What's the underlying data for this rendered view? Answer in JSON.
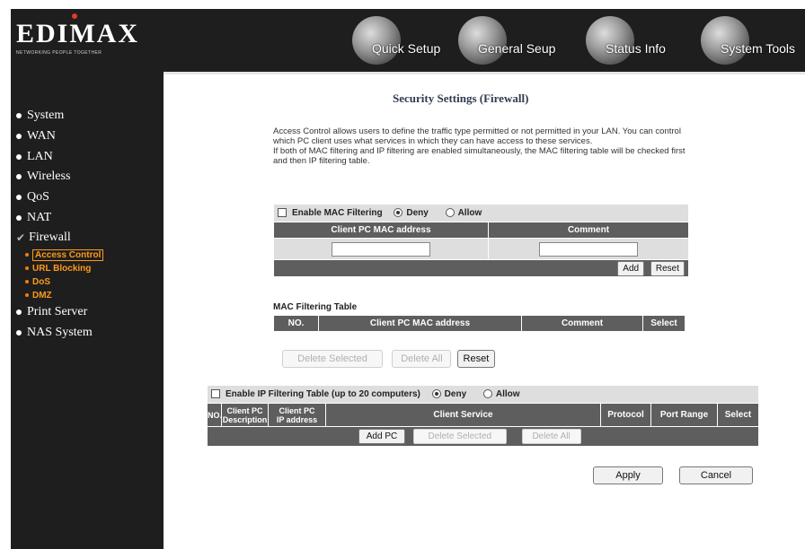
{
  "brand": {
    "name": "EDIMAX",
    "tagline": "NETWORKING PEOPLE TOGETHER"
  },
  "nav": {
    "quick_setup": "Quick Setup",
    "general_setup": "General Seup",
    "status_info": "Status Info",
    "system_tools": "System Tools"
  },
  "sidebar": {
    "items": [
      {
        "label": "System"
      },
      {
        "label": "WAN"
      },
      {
        "label": "LAN"
      },
      {
        "label": "Wireless"
      },
      {
        "label": "QoS"
      },
      {
        "label": "NAT"
      },
      {
        "label": "Firewall"
      },
      {
        "label": "Print Server"
      },
      {
        "label": "NAS System"
      }
    ],
    "firewall_sub": [
      {
        "label": "Access Control"
      },
      {
        "label": "URL Blocking"
      },
      {
        "label": "DoS"
      },
      {
        "label": "DMZ"
      }
    ]
  },
  "page": {
    "title": "Security Settings (Firewall)",
    "desc1": "Access Control allows users to define the traffic type permitted or not permitted in your LAN. You can control which PC client uses what services in which they can have access to these services.",
    "desc2": "If both of MAC filtering and IP filtering are enabled simultaneously, the MAC filtering table will be checked first and then IP filtering table."
  },
  "mac_filter": {
    "enable_label": "Enable MAC Filtering",
    "deny_label": "Deny",
    "allow_label": "Allow",
    "col_mac": "Client PC MAC address",
    "col_comment": "Comment",
    "add_label": "Add",
    "reset_label": "Reset"
  },
  "mac_table": {
    "title": "MAC Filtering Table",
    "col_no": "NO.",
    "col_mac": "Client PC MAC address",
    "col_comment": "Comment",
    "col_select": "Select",
    "delete_selected_label": "Delete Selected",
    "delete_all_label": "Delete All",
    "reset_label": "Reset"
  },
  "ip_filter": {
    "enable_label": "Enable IP Filtering Table (up to 20 computers)",
    "deny_label": "Deny",
    "allow_label": "Allow",
    "col_no": "NO.",
    "col_desc_1": "Client PC",
    "col_desc_2": "Description",
    "col_ip_1": "Client PC",
    "col_ip_2": "IP address",
    "col_service": "Client Service",
    "col_protocol": "Protocol",
    "col_port_range": "Port Range",
    "col_select": "Select",
    "add_pc_label": "Add PC",
    "delete_selected_label": "Delete Selected",
    "delete_all_label": "Delete All"
  },
  "footer": {
    "apply_label": "Apply",
    "cancel_label": "Cancel"
  }
}
